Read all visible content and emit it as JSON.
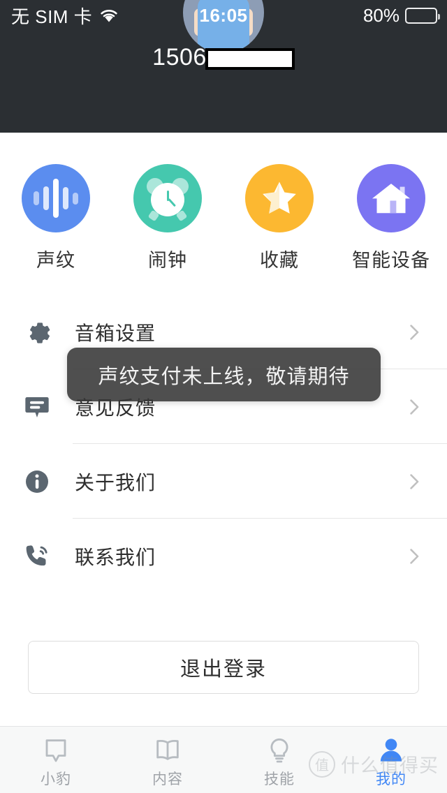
{
  "status_bar": {
    "carrier": "无 SIM 卡",
    "wifi_icon": "wifi-icon",
    "time": "16:05",
    "battery_percent": "80%",
    "battery_level": 80
  },
  "profile": {
    "avatar_icon": "user-avatar",
    "phone_prefix": "1506",
    "phone_redacted": true
  },
  "shortcuts": [
    {
      "label": "声纹",
      "icon": "voiceprint-icon",
      "color": "#5b8def"
    },
    {
      "label": "闹钟",
      "icon": "alarm-clock-icon",
      "color": "#45c8ae"
    },
    {
      "label": "收藏",
      "icon": "star-icon",
      "color": "#fcb831"
    },
    {
      "label": "智能设备",
      "icon": "home-device-icon",
      "color": "#7b74f2"
    }
  ],
  "menu": [
    {
      "label": "音箱设置",
      "icon": "gear-icon",
      "chevron": "chevron-right-icon"
    },
    {
      "label": "意见反馈",
      "icon": "feedback-icon",
      "chevron": "chevron-right-icon"
    },
    {
      "label": "关于我们",
      "icon": "info-icon",
      "chevron": "chevron-right-icon"
    },
    {
      "label": "联系我们",
      "icon": "phone-icon",
      "chevron": "chevron-right-icon"
    }
  ],
  "logout": {
    "label": "退出登录"
  },
  "toast": {
    "message": "声纹支付未上线，敬请期待"
  },
  "tabbar": {
    "items": [
      {
        "label": "小豹",
        "icon": "chat-bubble-icon",
        "active": false
      },
      {
        "label": "内容",
        "icon": "book-icon",
        "active": false
      },
      {
        "label": "技能",
        "icon": "lightbulb-icon",
        "active": false
      },
      {
        "label": "我的",
        "icon": "person-icon",
        "active": true
      }
    ],
    "active_color": "#4187f5",
    "inactive_color": "#9fa3a8"
  },
  "watermark": {
    "mark": "值",
    "text": "什么值得买"
  }
}
